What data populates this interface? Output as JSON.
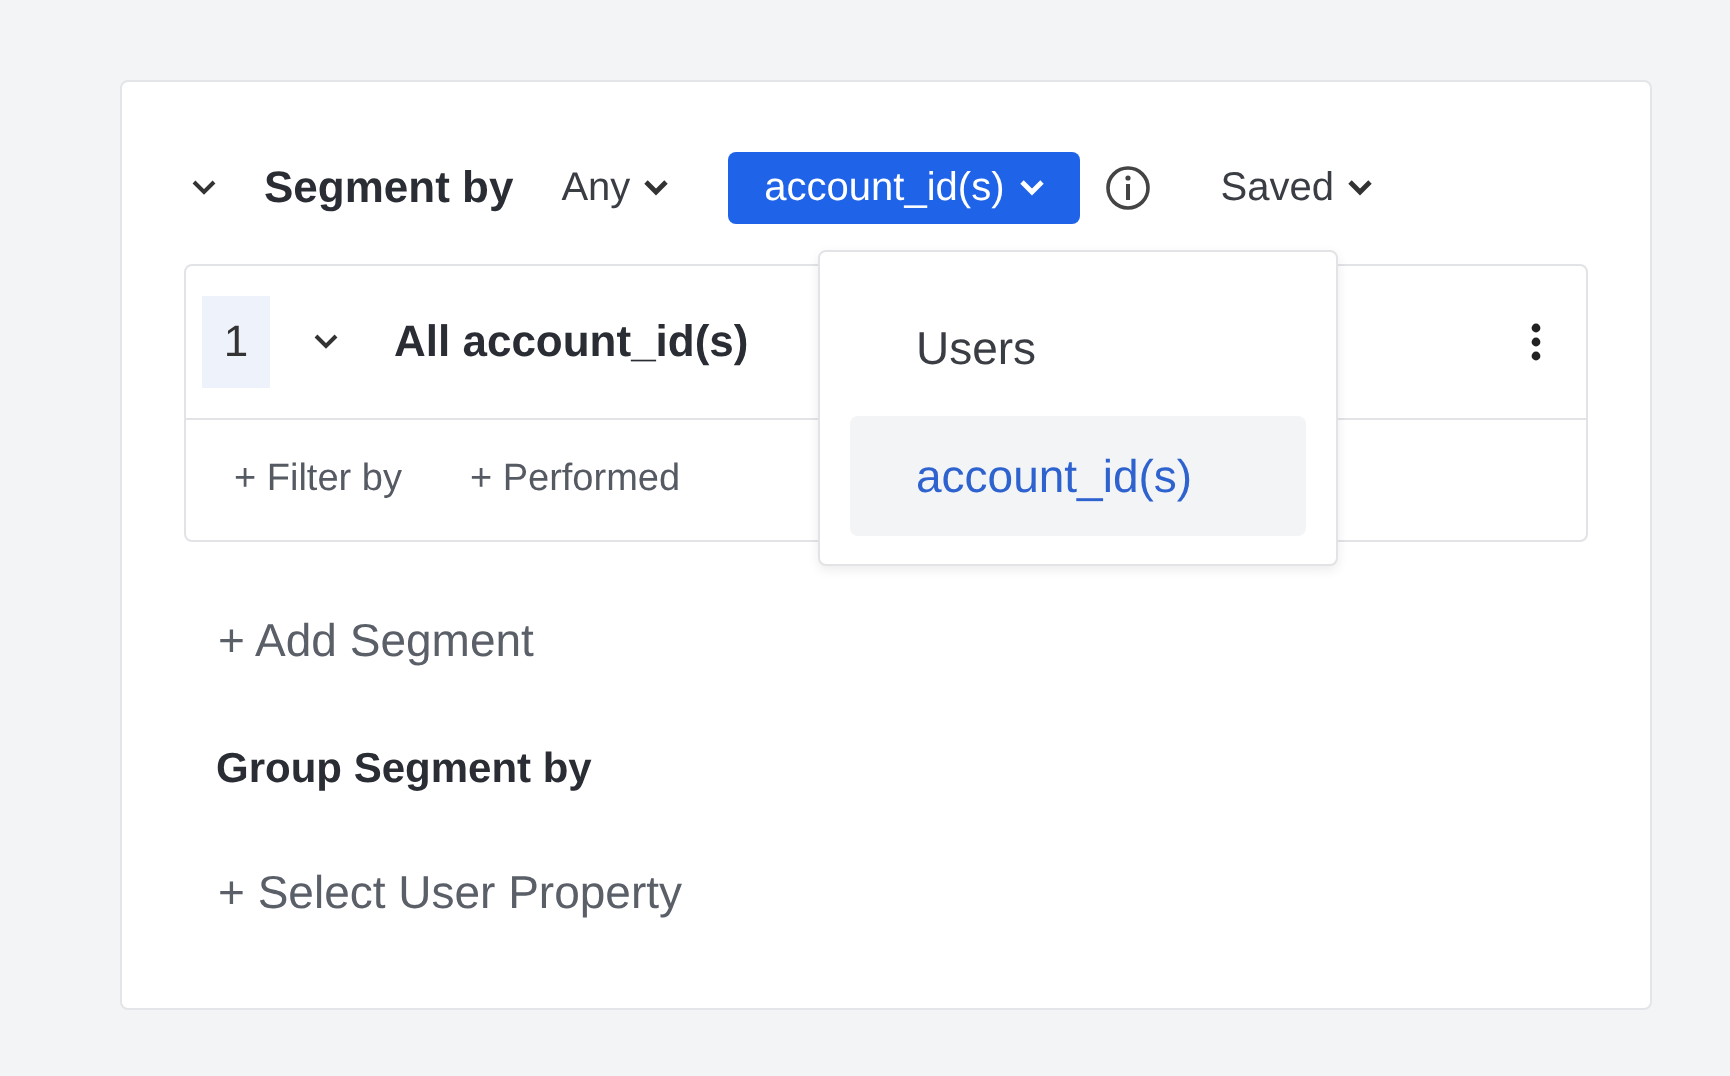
{
  "header": {
    "title": "Segment by",
    "match": "Any",
    "entity": "account_id(s)",
    "saved": "Saved"
  },
  "entity_menu": {
    "open": true,
    "items": [
      {
        "label": "Users",
        "selected": false
      },
      {
        "label": "account_id(s)",
        "selected": true
      }
    ]
  },
  "segments": [
    {
      "index": "1",
      "title": "All account_id(s)",
      "actions": [
        "+ Filter by",
        "+ Performed"
      ]
    }
  ],
  "add_segment": "+ Add Segment",
  "group_title": "Group Segment by",
  "group_action": "+ Select User Property"
}
